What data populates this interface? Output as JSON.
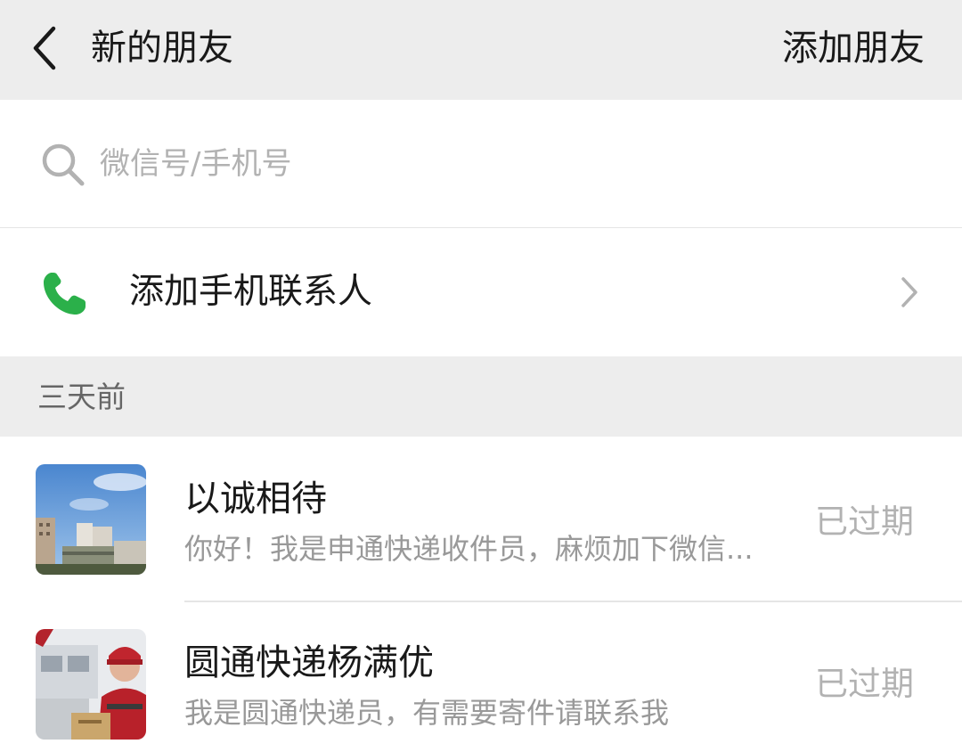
{
  "header": {
    "title": "新的朋友",
    "action_label": "添加朋友"
  },
  "search": {
    "placeholder": "微信号/手机号",
    "value": ""
  },
  "contacts_entry": {
    "label": "添加手机联系人",
    "icon": "phone-icon",
    "icon_color": "#07c160"
  },
  "section": {
    "label": "三天前"
  },
  "requests": [
    {
      "name": "以诚相待",
      "message": "你好！我是申通快递收件员，麻烦加下微信...",
      "status": "已过期"
    },
    {
      "name": "圆通快递杨满优",
      "message": "我是圆通快递员，有需要寄件请联系我",
      "status": "已过期"
    }
  ],
  "colors": {
    "header_bg": "#ededed",
    "muted_text": "#999999",
    "status_text": "#b2b2b2"
  }
}
